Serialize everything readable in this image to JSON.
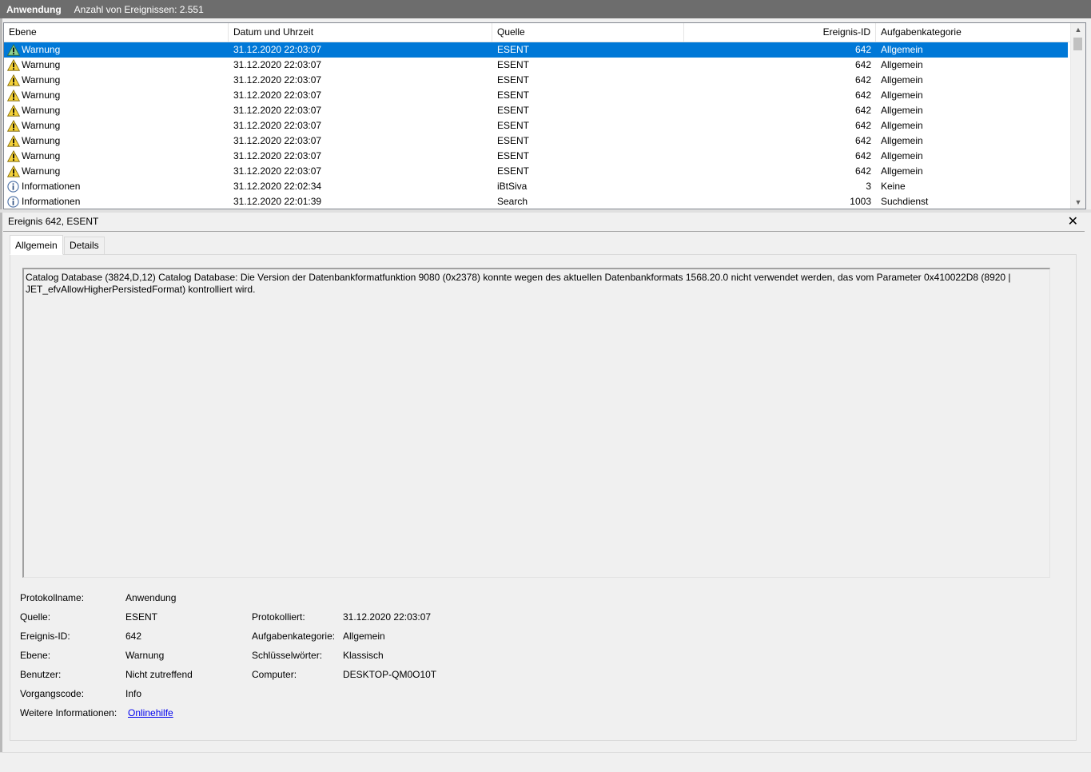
{
  "title": {
    "log": "Anwendung",
    "count": "Anzahl von Ereignissen: 2.551"
  },
  "columns": {
    "level": "Ebene",
    "datetime": "Datum und Uhrzeit",
    "source": "Quelle",
    "id": "Ereignis-ID",
    "category": "Aufgabenkategorie"
  },
  "rows": [
    {
      "icon": "warning",
      "level": "Warnung",
      "datetime": "31.12.2020 22:03:07",
      "source": "ESENT",
      "id": "642",
      "category": "Allgemein",
      "selected": true
    },
    {
      "icon": "warning",
      "level": "Warnung",
      "datetime": "31.12.2020 22:03:07",
      "source": "ESENT",
      "id": "642",
      "category": "Allgemein"
    },
    {
      "icon": "warning",
      "level": "Warnung",
      "datetime": "31.12.2020 22:03:07",
      "source": "ESENT",
      "id": "642",
      "category": "Allgemein"
    },
    {
      "icon": "warning",
      "level": "Warnung",
      "datetime": "31.12.2020 22:03:07",
      "source": "ESENT",
      "id": "642",
      "category": "Allgemein"
    },
    {
      "icon": "warning",
      "level": "Warnung",
      "datetime": "31.12.2020 22:03:07",
      "source": "ESENT",
      "id": "642",
      "category": "Allgemein"
    },
    {
      "icon": "warning",
      "level": "Warnung",
      "datetime": "31.12.2020 22:03:07",
      "source": "ESENT",
      "id": "642",
      "category": "Allgemein"
    },
    {
      "icon": "warning",
      "level": "Warnung",
      "datetime": "31.12.2020 22:03:07",
      "source": "ESENT",
      "id": "642",
      "category": "Allgemein"
    },
    {
      "icon": "warning",
      "level": "Warnung",
      "datetime": "31.12.2020 22:03:07",
      "source": "ESENT",
      "id": "642",
      "category": "Allgemein"
    },
    {
      "icon": "warning",
      "level": "Warnung",
      "datetime": "31.12.2020 22:03:07",
      "source": "ESENT",
      "id": "642",
      "category": "Allgemein"
    },
    {
      "icon": "info",
      "level": "Informationen",
      "datetime": "31.12.2020 22:02:34",
      "source": "iBtSiva",
      "id": "3",
      "category": "Keine"
    },
    {
      "icon": "info",
      "level": "Informationen",
      "datetime": "31.12.2020 22:01:39",
      "source": "Search",
      "id": "1003",
      "category": "Suchdienst"
    }
  ],
  "detail": {
    "title": "Ereignis 642, ESENT",
    "close_glyph": "✕",
    "tabs": [
      "Allgemein",
      "Details"
    ],
    "description": "Catalog Database (3824,D,12) Catalog Database: Die Version der Datenbankformatfunktion 9080 (0x2378) konnte wegen des aktuellen Datenbankformats 1568.20.0 nicht verwendet werden, das vom Parameter 0x410022D8 (8920 | JET_efvAllowHigherPersistedFormat) kontrolliert wird.",
    "props": {
      "logname_label": "Protokollname:",
      "logname": "Anwendung",
      "source_label": "Quelle:",
      "source": "ESENT",
      "logged_label": "Protokolliert:",
      "logged": "31.12.2020 22:03:07",
      "eventid_label": "Ereignis-ID:",
      "eventid": "642",
      "category_label": "Aufgabenkategorie:",
      "category": "Allgemein",
      "level_label": "Ebene:",
      "level": "Warnung",
      "keywords_label": "Schlüsselwörter:",
      "keywords": "Klassisch",
      "user_label": "Benutzer:",
      "user": "Nicht zutreffend",
      "computer_label": "Computer:",
      "computer": "DESKTOP-QM0O10T",
      "opcode_label": "Vorgangscode:",
      "opcode": "Info",
      "moreinfo_label": "Weitere Informationen:",
      "moreinfo_link": "Onlinehilfe"
    }
  }
}
